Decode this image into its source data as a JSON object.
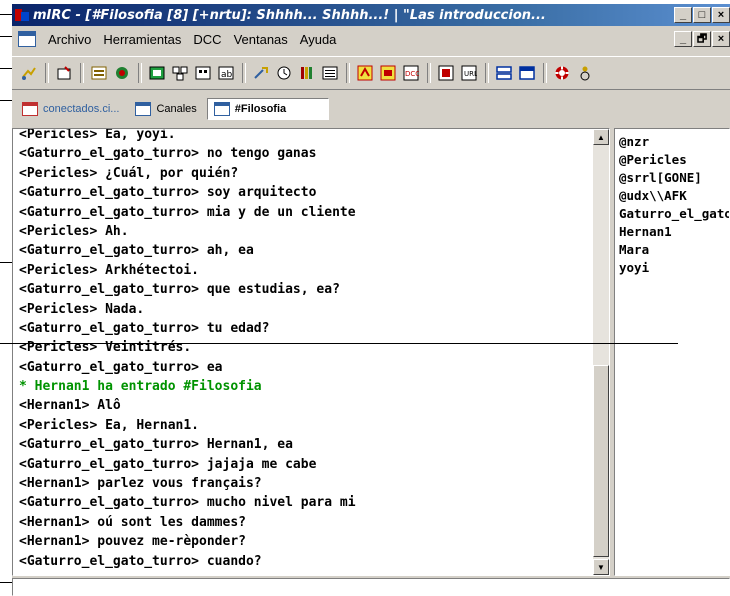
{
  "window": {
    "title": "mIRC - [#Filosofia [8] [+nrtu]: Shhhh... Shhhh...! | \"Las introduccion...",
    "title_buttons": [
      "_",
      "□",
      "×"
    ]
  },
  "menu": {
    "items": [
      "Archivo",
      "Herramientas",
      "DCC",
      "Ventanas",
      "Ayuda"
    ],
    "mdi_buttons": [
      "_",
      "🗗",
      "×"
    ]
  },
  "toolbar": {
    "icons": [
      "connect-icon",
      "options-icon",
      "channel-list-icon",
      "address-book-icon",
      "colors-icon",
      "dcc-icon",
      "notify-icon",
      "timer-icon",
      "url-icon",
      "log-icon",
      "list-icon",
      "tile-icon",
      "cascade-icon",
      "help-icon",
      "about-icon"
    ]
  },
  "switchbar": {
    "tabs": [
      {
        "label": "conectados.ci...",
        "active": false
      },
      {
        "label": "Canales",
        "active": false
      },
      {
        "label": "#Filosofia",
        "active": true
      }
    ]
  },
  "chat": {
    "lines": [
      {
        "text": "<Pericles> Ea, yoyi.",
        "kind": "msg"
      },
      {
        "text": "<Gaturro_el_gato_turro> no tengo ganas",
        "kind": "msg"
      },
      {
        "text": "<Pericles> ¿Cuál, por quién?",
        "kind": "msg"
      },
      {
        "text": "<Gaturro_el_gato_turro> soy arquitecto",
        "kind": "msg"
      },
      {
        "text": "<Gaturro_el_gato_turro> mia y de un cliente",
        "kind": "msg"
      },
      {
        "text": "<Pericles> Ah.",
        "kind": "msg"
      },
      {
        "text": "<Gaturro_el_gato_turro> ah, ea",
        "kind": "msg"
      },
      {
        "text": "<Pericles> Arkhétectoi.",
        "kind": "msg"
      },
      {
        "text": "<Gaturro_el_gato_turro> que estudias, ea?",
        "kind": "msg"
      },
      {
        "text": "<Pericles> Nada.",
        "kind": "msg"
      },
      {
        "text": "<Gaturro_el_gato_turro> tu edad?",
        "kind": "msg"
      },
      {
        "text": "<Pericles> Veintitrés.",
        "kind": "msg"
      },
      {
        "text": "<Gaturro_el_gato_turro> ea",
        "kind": "msg"
      },
      {
        "text": "* Hernan1 ha entrado #Filosofia",
        "kind": "join"
      },
      {
        "text": "<Hernan1> Alô",
        "kind": "msg"
      },
      {
        "text": "<Pericles> Ea, Hernan1.",
        "kind": "msg"
      },
      {
        "text": "<Gaturro_el_gato_turro> Hernan1, ea",
        "kind": "msg"
      },
      {
        "text": "<Gaturro_el_gato_turro> jajaja me cabe",
        "kind": "msg"
      },
      {
        "text": "<Hernan1> parlez vous français?",
        "kind": "msg"
      },
      {
        "text": "<Gaturro_el_gato_turro> mucho nivel para mi",
        "kind": "msg"
      },
      {
        "text": "<Hernan1> oú sont les dammes?",
        "kind": "msg"
      },
      {
        "text": "<Hernan1> pouvez me-rèponder?",
        "kind": "msg"
      },
      {
        "text": "<Gaturro_el_gato_turro> cuando?",
        "kind": "msg"
      }
    ],
    "scroll_up": "▲",
    "scroll_down": "▼"
  },
  "nicklist": [
    "@nzr",
    "@Pericles",
    "@srrl[GONE]",
    "@udx\\\\AFK",
    "Gaturro_el_gato_turro",
    "Hernan1",
    "Mara",
    "yoyi"
  ],
  "input": {
    "value": ""
  },
  "colors": {
    "join": "#009300",
    "titlebar": "#0a246a"
  }
}
